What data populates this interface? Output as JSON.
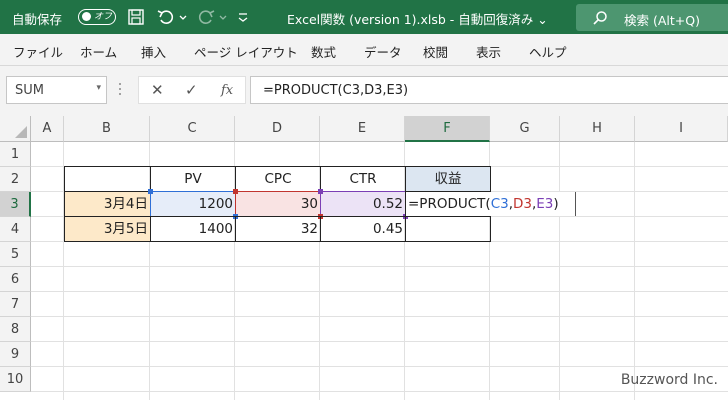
{
  "titlebar": {
    "autosave_label": "自動保存",
    "toggle_state": "オフ",
    "document_title": "Excel関数 (version 1).xlsb  -  自動回復済み  ⌄",
    "search_text": "検索 (Alt+Q)"
  },
  "menu": {
    "items": [
      "ファイル",
      "ホーム",
      "挿入",
      "ページ レイアウト",
      "数式",
      "データ",
      "校閲",
      "表示",
      "ヘルプ"
    ]
  },
  "formula_bar": {
    "name_box": "SUM",
    "name_box_arrow": "▾",
    "cancel_glyph": "✕",
    "enter_glyph": "✓",
    "fx_glyph": "fx",
    "formula": "=PRODUCT(C3,D3,E3)"
  },
  "sheet": {
    "columns": [
      "A",
      "B",
      "C",
      "D",
      "E",
      "F",
      "G",
      "H",
      "I"
    ],
    "rows": [
      "1",
      "2",
      "3",
      "4",
      "5",
      "6",
      "7",
      "8",
      "9",
      "10"
    ],
    "selected_column": "F",
    "selected_row": "3",
    "headers": {
      "C": "PV",
      "D": "CPC",
      "E": "CTR",
      "F": "収益"
    },
    "row3": {
      "B": "3月4日",
      "C": "1200",
      "D": "30",
      "E": "0.52"
    },
    "row4": {
      "B": "3月5日",
      "C": "1400",
      "D": "32",
      "E": "0.45"
    },
    "editing_cell": {
      "prefix": "=PRODUCT(",
      "ref1": "C3",
      "sep1": ",",
      "ref2": "D3",
      "sep2": ",",
      "ref3": "E3",
      "suffix": ")"
    }
  },
  "colors": {
    "title_bar": "#217346",
    "header_fill_F": "#dce6f1",
    "date_fill": "#fde9c9",
    "ref_c": "#2f6fd6",
    "ref_d": "#c1352f",
    "ref_e": "#7b3fb5",
    "fill_c": "#e6edf9",
    "fill_d": "#f9e3e3",
    "fill_e": "#ece3f6"
  },
  "watermark": "Buzzword Inc."
}
